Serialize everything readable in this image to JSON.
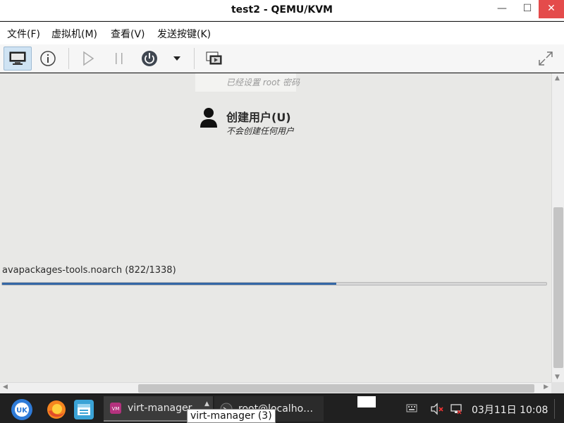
{
  "window": {
    "title": "test2 - QEMU/KVM",
    "minimize_glyph": "—",
    "maximize_glyph": "☐",
    "close_glyph": "✕"
  },
  "menu": [
    "文件(F)",
    "虚拟机(M)",
    "查看(V)",
    "发送按键(K)"
  ],
  "toolbar": {
    "buttons": [
      "monitor-icon",
      "info-icon",
      "play-icon",
      "pause-icon",
      "power-icon",
      "dropdown-arrow-icon",
      "snapshots-icon",
      "fullscreen-icon"
    ],
    "active": "monitor-icon"
  },
  "guest": {
    "root_status": "已经设置 root 密码",
    "user_title": "创建用户(U)",
    "user_status": "不会创建任何用户",
    "progress_text": "avapackages-tools.noarch (822/1338)",
    "progress_done": 822,
    "progress_total": 1338
  },
  "taskbar": {
    "launchers": [
      "uk-logo-icon",
      "firefox-icon",
      "file-manager-icon"
    ],
    "tasks": [
      {
        "label": "virt-manager",
        "icon": "virt-manager-icon",
        "active": true
      },
      {
        "label": "root@localho…",
        "icon": "terminal-icon",
        "active": false
      }
    ],
    "tray": [
      "keyboard-icon",
      "volume-muted-icon",
      "network-icon"
    ],
    "clock": "03月11日 10:08",
    "tooltip": "virt-manager (3)"
  },
  "colors": {
    "progress": "#3467a6",
    "close_button": "#e44b4b",
    "active_toolbar_button": "#cfe3f3",
    "taskbar": "#202020"
  }
}
